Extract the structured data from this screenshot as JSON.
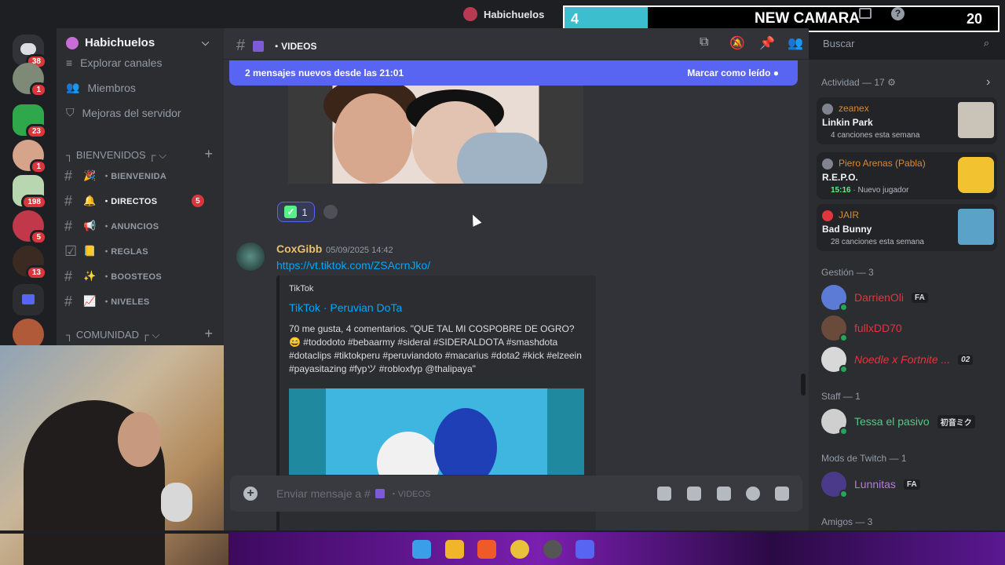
{
  "window": {
    "title": "Habichuelos"
  },
  "overlay": {
    "left": "4",
    "center": "NEW CAMARA",
    "right": "20"
  },
  "servers": [
    {
      "name": "discord-home",
      "badge": "38"
    },
    {
      "name": "server-1",
      "badge": "1"
    },
    {
      "name": "server-2",
      "badge": "23"
    },
    {
      "name": "server-3",
      "badge": "1"
    },
    {
      "name": "server-4",
      "badge": "198"
    },
    {
      "name": "server-5",
      "badge": "5"
    },
    {
      "name": "server-6",
      "badge": "13"
    },
    {
      "name": "folder",
      "badge": ""
    },
    {
      "name": "server-7",
      "badge": ""
    }
  ],
  "sidebar": {
    "server_name": "Habichuelos",
    "items": [
      "Explorar canales",
      "Miembros",
      "Mejoras del servidor"
    ],
    "categories": [
      "┐ BIENVENIDOS ┌",
      "┐ COMUNIDAD ┌"
    ],
    "channels": [
      {
        "emoji": "🎉",
        "name": "・BIENVENIDA",
        "badge": ""
      },
      {
        "emoji": "🔔",
        "name": "・DIRECTOS",
        "badge": "5"
      },
      {
        "emoji": "📢",
        "name": "・ANUNCIOS",
        "badge": ""
      },
      {
        "emoji": "📒",
        "name": "・REGLAS",
        "badge": ""
      },
      {
        "emoji": "✨",
        "name": "・BOOSTEOS",
        "badge": ""
      },
      {
        "emoji": "📈",
        "name": "・NIVELES",
        "badge": ""
      }
    ]
  },
  "header": {
    "channel": "・VIDEOS",
    "search_placeholder": "Buscar"
  },
  "chat": {
    "new_messages": "2 mensajes nuevos desde las 21:01",
    "mark_read": "Marcar como leído",
    "reaction_count": "1",
    "message": {
      "author": "CoxGibb",
      "timestamp": "05/09/2025 14:42",
      "link": "https://vt.tiktok.com/ZSAcrnJko/",
      "embed_provider": "TikTok",
      "embed_title": "TikTok · Peruvian DoTa",
      "embed_desc": "70 me gusta, 4 comentarios. \"QUE TAL MI COSPOBRE DE OGRO? 😄 #tododoto #bebaarmy #sideral #SIDERALDOTA #smashdota #dotaclips #tiktokperu #peruviandoto #macarius #dota2 #kick #elzeein #payasitazing #fypツ #robloxfyp @thalipaya\""
    },
    "composer_placeholder": "Enviar mensaje a #",
    "composer_channel": "・VIDEOS"
  },
  "members": {
    "activity_title": "Actividad — 17",
    "activities": [
      {
        "user": "zeanex",
        "title": "Linkin Park",
        "sub": "4 canciones esta semana",
        "sub_time": ""
      },
      {
        "user": "Piero Arenas (Pabla)",
        "title": "R.E.P.O.",
        "sub": "Nuevo jugador",
        "sub_time": "15:16"
      },
      {
        "user": "JAIR",
        "title": "Bad Bunny",
        "sub": "28 canciones esta semana",
        "sub_time": ""
      }
    ],
    "groups": [
      {
        "title": "Gestión — 3"
      },
      {
        "title": "Staff — 1"
      },
      {
        "title": "Mods de Twitch — 1"
      },
      {
        "title": "Amigos — 3"
      }
    ],
    "list": [
      {
        "name": "DarrienOli",
        "tag": "FA",
        "color": "#e0373d"
      },
      {
        "name": "fullxDD70",
        "tag": "",
        "color": "#e0373d"
      },
      {
        "name": "Noedle x Fortnite ...",
        "tag": "02",
        "color": "#e0373d"
      },
      {
        "name": "Tessa el pasivo",
        "tag": "初音ミク",
        "color": "#57c785"
      },
      {
        "name": "Lunnitas",
        "tag": "FA",
        "color": "#b57ad8"
      }
    ]
  },
  "colors": {
    "accent": "#5865f2",
    "link": "#00a8fc",
    "danger": "#da373c",
    "online": "#23a55a"
  }
}
